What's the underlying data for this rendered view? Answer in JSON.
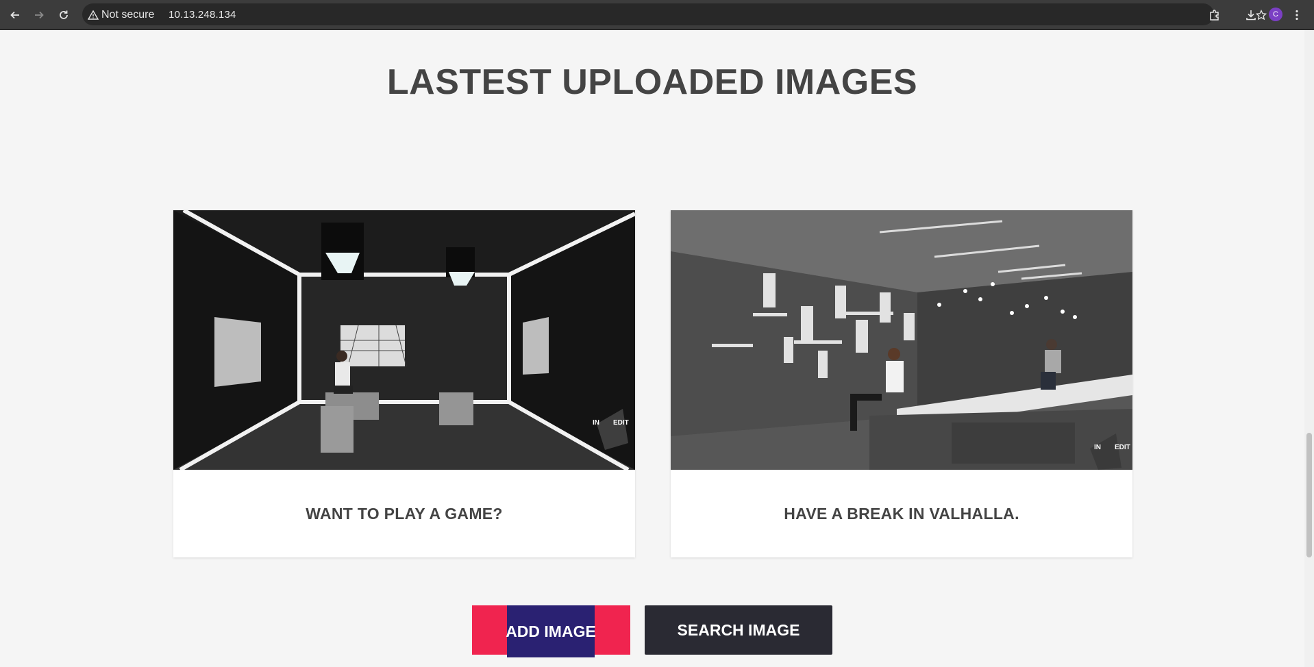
{
  "browser": {
    "security_label": "Not secure",
    "url": "10.13.248.134",
    "profile_initial": "C"
  },
  "page": {
    "title": "LASTEST UPLOADED IMAGES",
    "cards": [
      {
        "caption": "WANT TO PLAY A GAME?",
        "watermark_left": "IN",
        "watermark_right": "EDIT"
      },
      {
        "caption": "HAVE A BREAK IN VALHALLA.",
        "watermark_left": "IN",
        "watermark_right": "EDIT"
      }
    ],
    "buttons": {
      "add_image": "ADD IMAGE",
      "search_image": "SEARCH IMAGE"
    }
  },
  "colors": {
    "add_button_bg": "#f0244f",
    "add_button_inner": "#2a2172",
    "search_button_bg": "#2a2a33",
    "title_text": "#444444"
  },
  "icons": [
    "back-arrow-icon",
    "forward-arrow-icon",
    "reload-icon",
    "warning-icon",
    "star-icon",
    "extensions-icon",
    "download-icon",
    "menu-dots-icon"
  ]
}
